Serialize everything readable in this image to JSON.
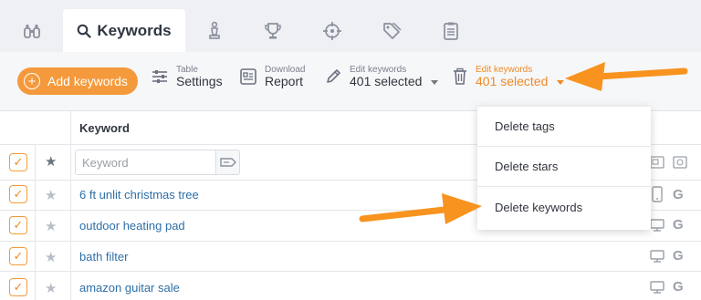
{
  "tabs": [
    {
      "name": "binoculars-icon",
      "label": ""
    },
    {
      "name": "search-icon",
      "label": "Keywords",
      "active": true
    },
    {
      "name": "chess-icon",
      "label": ""
    },
    {
      "name": "trophy-icon",
      "label": ""
    },
    {
      "name": "crosshair-icon",
      "label": ""
    },
    {
      "name": "tags-icon",
      "label": ""
    },
    {
      "name": "clipboard-icon",
      "label": ""
    }
  ],
  "toolbar": {
    "add_label": "Add keywords",
    "table_small": "Table",
    "table_big": "Settings",
    "download_small": "Download",
    "download_big": "Report",
    "edit_small": "Edit keywords",
    "edit_big": "401 selected",
    "delete_small": "Edit keywords",
    "delete_big": "401 selected"
  },
  "table": {
    "column_header": "Keyword",
    "filter_placeholder": "Keyword",
    "rows": [
      {
        "keyword": "6 ft unlit christmas tree",
        "device": "mobile-icon"
      },
      {
        "keyword": "outdoor heating pad",
        "device": "desktop-icon"
      },
      {
        "keyword": "bath filter",
        "device": "desktop-icon"
      },
      {
        "keyword": "amazon guitar sale",
        "device": "desktop-icon"
      }
    ],
    "search_engine_icon": "google-icon",
    "check_glyph": "✓",
    "star_glyph": "★",
    "google_glyph": "G"
  },
  "dropdown": {
    "items": [
      "Delete tags",
      "Delete stars",
      "Delete keywords"
    ]
  },
  "colors": {
    "accent": "#f59a3c",
    "accent_text": "#f08a24",
    "link": "#2e6fa7",
    "tabbar_bg": "#eef0f4"
  }
}
